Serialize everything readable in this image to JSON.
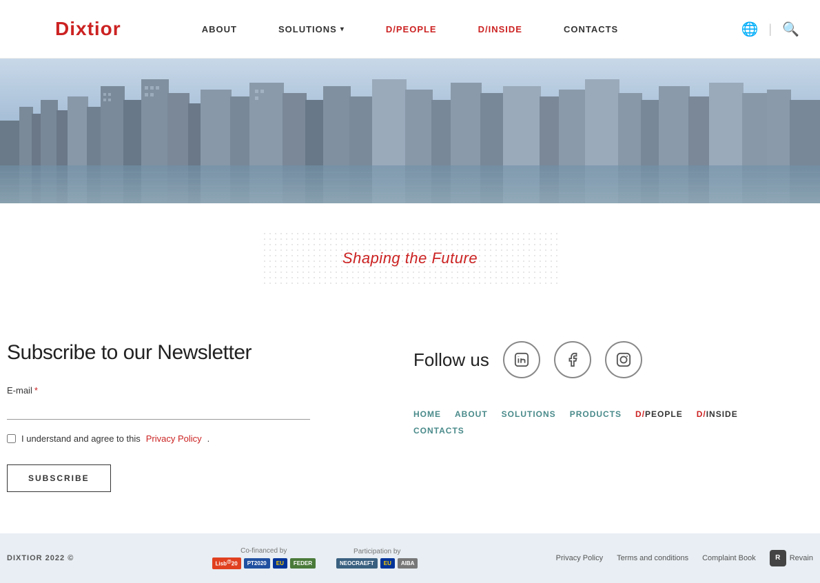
{
  "brand": {
    "name": "Dixtior",
    "logo_text": "Dixtior"
  },
  "navbar": {
    "links": [
      {
        "id": "about",
        "label": "ABOUT",
        "red": false,
        "hasChevron": false
      },
      {
        "id": "solutions",
        "label": "SOLUTIONS",
        "red": false,
        "hasChevron": true
      },
      {
        "id": "d-people",
        "label": "D/PEOPLE",
        "red": true,
        "hasChevron": false
      },
      {
        "id": "d-inside",
        "label": "D/INSIDE",
        "red": true,
        "hasChevron": false
      },
      {
        "id": "contacts",
        "label": "CONTACTS",
        "red": false,
        "hasChevron": false
      }
    ],
    "solutions_prefix": "SoLutionS"
  },
  "hero": {
    "tagline": "Shaping the Future"
  },
  "newsletter": {
    "title": "Subscribe to our Newsletter",
    "email_label": "E-mail",
    "email_placeholder": "",
    "checkbox_text": "I understand and agree to this ",
    "privacy_link": "Privacy Policy",
    "subscribe_btn": "SUBSCRIBE"
  },
  "follow": {
    "title": "Follow us",
    "social": [
      {
        "id": "linkedin",
        "symbol": "in"
      },
      {
        "id": "facebook",
        "symbol": "f"
      },
      {
        "id": "instagram",
        "symbol": "◎"
      }
    ]
  },
  "footer_nav": {
    "row1": [
      {
        "id": "home",
        "label": "HOME",
        "red": false
      },
      {
        "id": "about",
        "label": "ABOUT",
        "red": false
      },
      {
        "id": "solutions",
        "label": "SOLUTIONS",
        "red": false
      },
      {
        "id": "products",
        "label": "PRODUCTS",
        "red": false
      },
      {
        "id": "d-people",
        "label": "D/PEOPLE",
        "red": true
      },
      {
        "id": "d-inside",
        "label": "D/INSIDE",
        "red": true
      }
    ],
    "row2": [
      {
        "id": "contacts",
        "label": "CONTACTS",
        "red": false
      }
    ]
  },
  "bottom_footer": {
    "copyright": "DIXTIOR 2022 ©",
    "co_financed_label": "Co-financed by",
    "participation_label": "Participation by",
    "legal_links": [
      {
        "id": "privacy",
        "label": "Privacy Policy"
      },
      {
        "id": "terms",
        "label": "Terms and conditions"
      },
      {
        "id": "complaint",
        "label": "Complaint Book"
      }
    ],
    "revain_label": "Revain"
  }
}
